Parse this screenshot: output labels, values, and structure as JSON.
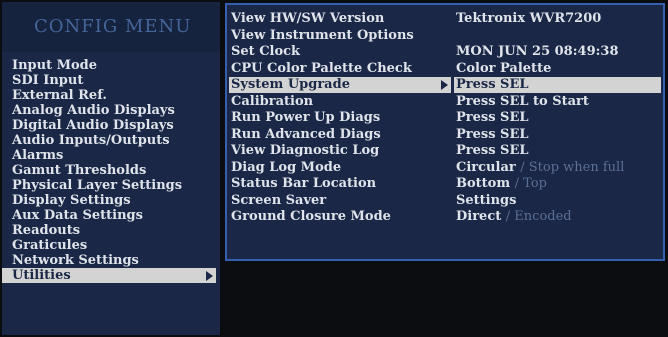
{
  "left": {
    "title": "CONFIG MENU",
    "items": [
      {
        "label": "Input Mode"
      },
      {
        "label": "SDI Input"
      },
      {
        "label": "External Ref."
      },
      {
        "label": "Analog Audio Displays"
      },
      {
        "label": "Digital Audio Displays"
      },
      {
        "label": "Audio Inputs/Outputs"
      },
      {
        "label": "Alarms"
      },
      {
        "label": "Gamut Thresholds"
      },
      {
        "label": "Physical Layer Settings"
      },
      {
        "label": "Display Settings"
      },
      {
        "label": "Aux Data Settings"
      },
      {
        "label": "Readouts"
      },
      {
        "label": "Graticules"
      },
      {
        "label": "Network Settings"
      },
      {
        "label": "Utilities",
        "selected": true
      }
    ]
  },
  "right": {
    "rows": [
      {
        "label": "View HW/SW Version",
        "value": "Tektronix WVR7200"
      },
      {
        "label": "View Instrument Options",
        "value": ""
      },
      {
        "label": "Set Clock",
        "value": "MON JUN 25 08:49:38"
      },
      {
        "label": "CPU Color Palette Check",
        "value": "Color Palette"
      },
      {
        "label": "System Upgrade",
        "value": "Press SEL",
        "selected": true
      },
      {
        "label": "Calibration",
        "value": "Press SEL to Start"
      },
      {
        "label": "Run Power Up Diags",
        "value": "Press SEL"
      },
      {
        "label": "Run Advanced Diags",
        "value": "Press SEL"
      },
      {
        "label": "View Diagnostic Log",
        "value": "Press SEL"
      },
      {
        "label": "Diag Log Mode",
        "value": "Circular",
        "alt": "/ Stop when full"
      },
      {
        "label": "Status Bar Location",
        "value": "Bottom",
        "alt": "/ Top"
      },
      {
        "label": "Screen Saver",
        "value": "Settings"
      },
      {
        "label": "Ground Closure Mode",
        "value": "Direct",
        "alt": "/ Encoded"
      }
    ]
  },
  "colors": {
    "panel_bg": "#1a2746",
    "highlight_bg": "#d3d3d3",
    "text": "#dfe3ea",
    "muted_text": "#5c6f94",
    "border": "#3560b0",
    "title_text": "#45659a"
  }
}
